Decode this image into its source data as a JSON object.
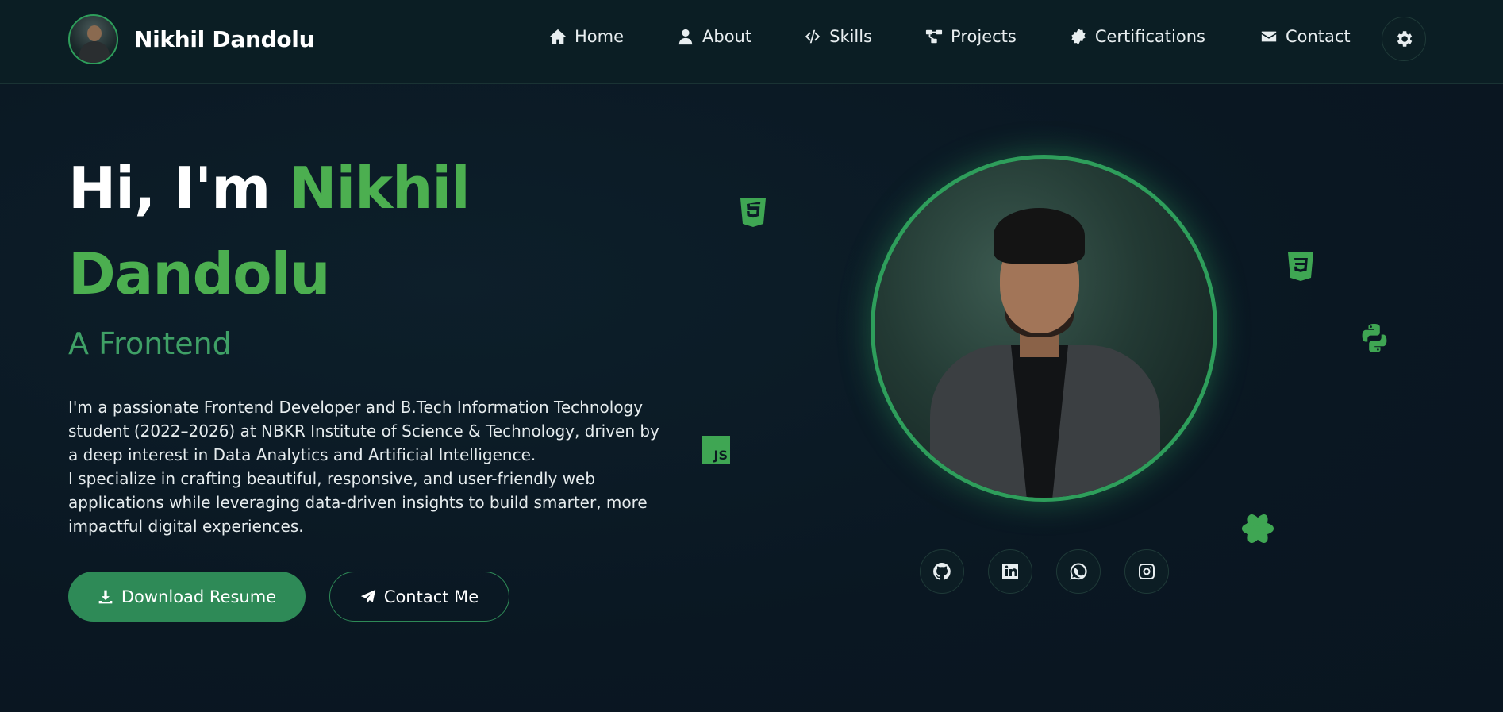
{
  "brand": {
    "name": "Nikhil Dandolu"
  },
  "nav": {
    "items": [
      {
        "label": "Home",
        "icon": "home-icon"
      },
      {
        "label": "About",
        "icon": "user-icon"
      },
      {
        "label": "Skills",
        "icon": "code-icon"
      },
      {
        "label": "Projects",
        "icon": "project-diagram-icon"
      },
      {
        "label": "Certifications",
        "icon": "certificate-icon"
      },
      {
        "label": "Contact",
        "icon": "envelope-icon"
      }
    ],
    "settings_icon": "gear-icon"
  },
  "hero": {
    "greeting": "Hi, I'm",
    "first_name": "Nikhil",
    "last_name": "Dandolu",
    "subtitle": "A Frontend",
    "description_1": "I'm a passionate Frontend Developer and B.Tech Information Technology student (2022–2026) at NBKR Institute of Science & Technology, driven by a deep interest in Data Analytics and Artificial Intelligence.",
    "description_2": "I specialize in crafting beautiful, responsive, and user-friendly web applications while leveraging data-driven insights to build smarter, more impactful digital experiences.",
    "download_button": "Download Resume",
    "contact_button": "Contact Me"
  },
  "social": [
    {
      "icon": "github-icon"
    },
    {
      "icon": "linkedin-icon"
    },
    {
      "icon": "whatsapp-icon"
    },
    {
      "icon": "instagram-icon"
    }
  ],
  "tech_icons": {
    "js_label": "JS",
    "items": [
      "html5-icon",
      "css3-icon",
      "python-icon",
      "javascript-icon",
      "react-icon"
    ]
  },
  "colors": {
    "accent": "#4caf50",
    "button": "#2e8a57",
    "background": "#0a1722",
    "header": "#0b1e24"
  }
}
